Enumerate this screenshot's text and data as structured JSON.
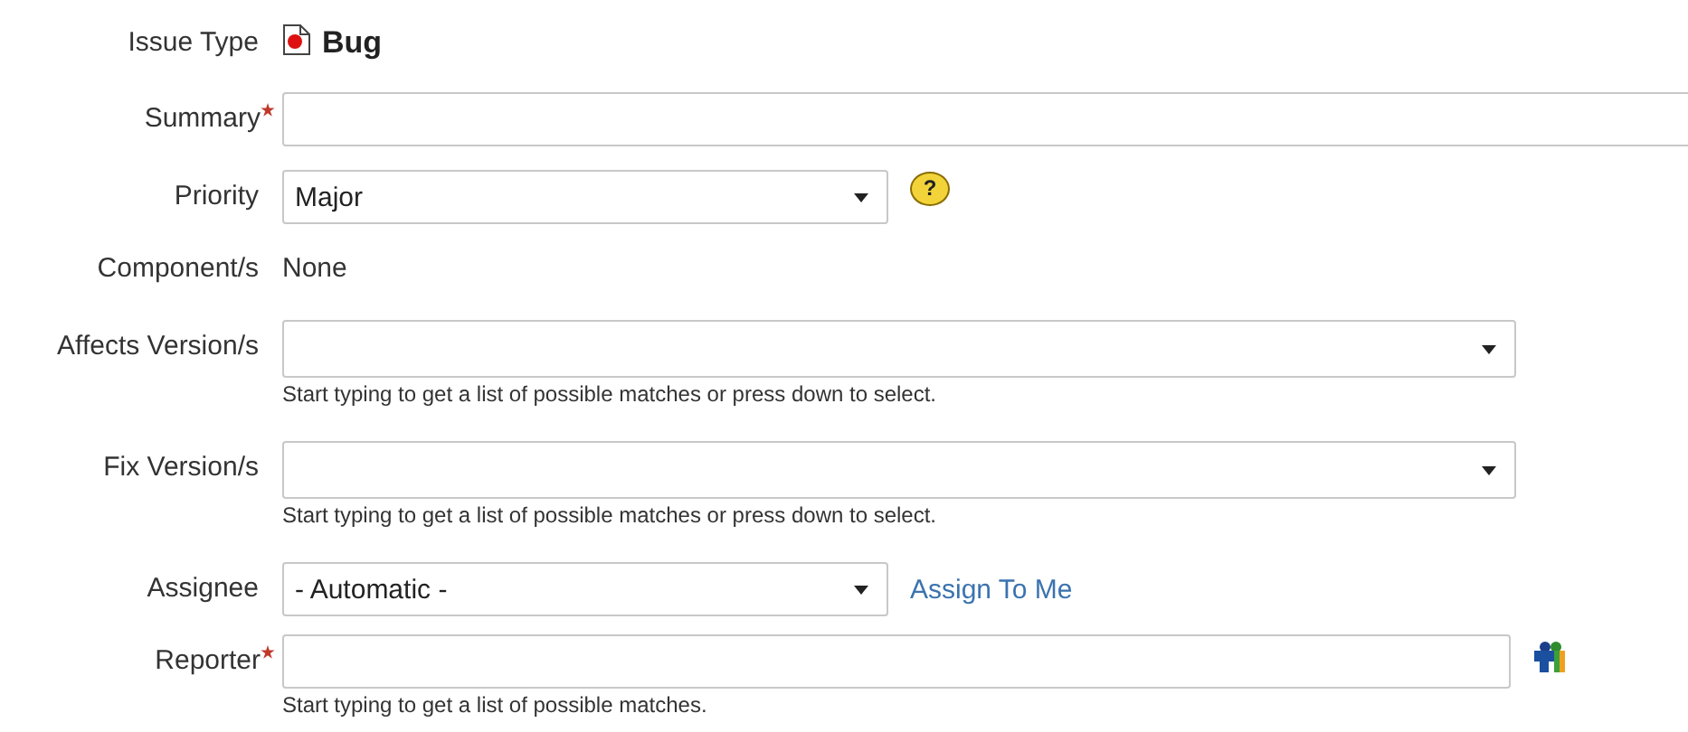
{
  "fields": [
    {
      "kind": "type",
      "label": "Issue Type",
      "required": false,
      "value": "Bug"
    },
    {
      "kind": "text",
      "label": "Summary",
      "required": true
    },
    {
      "kind": "select",
      "label": "Priority",
      "required": false,
      "value": "Major",
      "help": "?"
    },
    {
      "kind": "static",
      "label": "Component/s",
      "required": false,
      "value": "None"
    },
    {
      "kind": "combo",
      "label": "Affects Version/s",
      "required": false,
      "hint": "Start typing to get a list of possible matches or press down to select."
    },
    {
      "kind": "combo",
      "label": "Fix Version/s",
      "required": false,
      "hint": "Start typing to get a list of possible matches or press down to select."
    },
    {
      "kind": "select",
      "label": "Assignee",
      "required": false,
      "value": "- Automatic -",
      "link": "Assign To Me"
    },
    {
      "kind": "user",
      "label": "Reporter",
      "required": true,
      "hint": "Start typing to get a list of possible matches."
    }
  ]
}
